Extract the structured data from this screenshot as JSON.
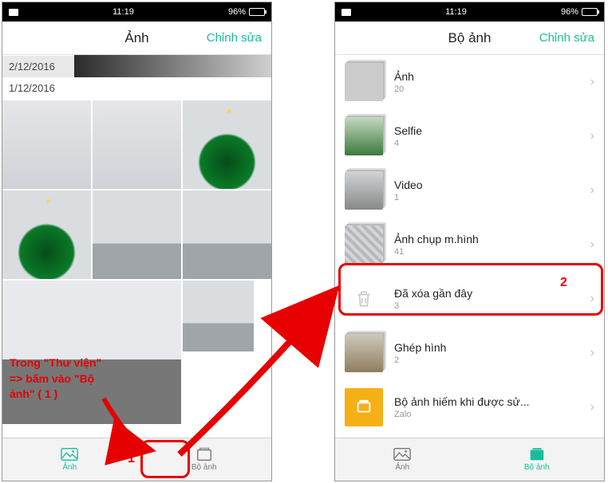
{
  "status": {
    "time": "11:19",
    "battery": "96%",
    "carrier_icon": "sim"
  },
  "left": {
    "title": "Ảnh",
    "edit": "Chỉnh sửa",
    "dates": [
      "2/12/2016",
      "1/12/2016"
    ],
    "tabs": {
      "photos": "Ảnh",
      "albums": "Bộ ảnh"
    }
  },
  "right": {
    "title": "Bộ ảnh",
    "edit": "Chỉnh sửa",
    "albums": [
      {
        "name": "Ảnh",
        "count": "20"
      },
      {
        "name": "Selfie",
        "count": "4"
      },
      {
        "name": "Video",
        "count": "1"
      },
      {
        "name": "Ảnh chụp m.hình",
        "count": "41"
      },
      {
        "name": "Đã xóa gần đây",
        "count": "3",
        "trash": true
      },
      {
        "name": "Ghép hình",
        "count": "2"
      },
      {
        "name": "Bộ ảnh hiếm khi được sử...",
        "count": "Zalo",
        "yellow": true
      }
    ],
    "tabs": {
      "photos": "Ảnh",
      "albums": "Bộ ảnh"
    }
  },
  "annotations": {
    "instruction_l1": "Trong \"Thư viện\"",
    "instruction_l2": "=> bấm vào \"Bộ",
    "instruction_l3": "ảnh\" ( 1 )",
    "marker1": "1",
    "marker2": "2"
  }
}
